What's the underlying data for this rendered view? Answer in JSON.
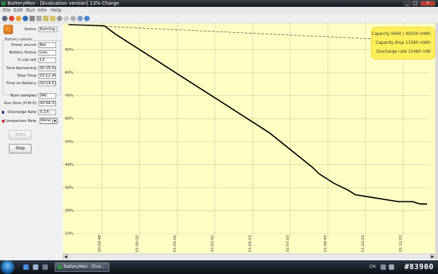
{
  "window": {
    "title": "BatteryMon - [Evaluation version] 13% Charge",
    "min": "_",
    "max": "□",
    "close": "×"
  },
  "menu": [
    "File",
    "Edit",
    "Run",
    "Info",
    "Help"
  ],
  "panel": {
    "status_label": "Status",
    "status_value": "Running",
    "group_title": "Battery details",
    "rows": [
      {
        "label": "Power source",
        "value": "Bat"
      },
      {
        "label": "Battery Status",
        "value": "Low"
      },
      {
        "label": "% Life left",
        "value": "13"
      },
      {
        "label": "Time Remaining",
        "value": "00:25:04"
      },
      {
        "label": "Total Time",
        "value": "03:12:49"
      },
      {
        "label": "Time on Battery",
        "value": "00:14:51"
      }
    ],
    "num_samples_label": "Num samples",
    "num_samples_value": "340",
    "run_time_label": "Run time (H:M:S)",
    "run_time_value": "00:56:33",
    "discharge_label": "Discharge Rate",
    "discharge_value": "3.2/h",
    "comparison_label": "Comparison Rate",
    "comparison_value": "None",
    "start_button": "Start",
    "stop_button": "Stop",
    "colors": {
      "discharge": "#1a1a80",
      "comparison": "#d42020"
    }
  },
  "info": {
    "capacity": "Capacity 6460 / 49330 mWh",
    "capacity_drop": "Capacity drop 11560 mWh",
    "discharge_rate": "Discharge rate 15480 mW"
  },
  "chart_data": {
    "type": "line",
    "y_ticks": [
      "10%",
      "20%",
      "30%",
      "40%",
      "50%",
      "60%",
      "70%",
      "80%",
      "90%"
    ],
    "x_ticks": [
      "00:59:48",
      "01:00:22",
      "01:02:02",
      "01:03:42",
      "01:05:23",
      "01:07:03",
      "01:08:43",
      "01:10:23",
      "01:12:03"
    ],
    "ylim": [
      10,
      100
    ],
    "grid": true,
    "background": "#ffffc4",
    "series": [
      {
        "style": "solid",
        "color": "#000000",
        "x": [
          0,
          0.1,
          0.13,
          0.16,
          0.2,
          0.24,
          0.28,
          0.32,
          0.36,
          0.4,
          0.44,
          0.48,
          0.52,
          0.56,
          0.6,
          0.64,
          0.68,
          0.7,
          0.74,
          0.78,
          0.8,
          0.84,
          0.88,
          0.92,
          0.96,
          0.98,
          1.0
        ],
        "values": [
          100,
          99.5,
          96,
          93,
          89,
          85,
          81,
          77,
          73,
          69,
          65,
          61,
          57,
          53,
          48,
          43,
          38,
          35,
          31,
          28,
          26,
          25,
          24,
          23,
          23,
          22,
          22
        ]
      },
      {
        "style": "dashed",
        "color": "#555555",
        "x": [
          0,
          1
        ],
        "values": [
          100,
          92.7
        ]
      }
    ]
  },
  "taskbar": {
    "task_label": "BatteryMon - [Eva...",
    "tray_lang": "CH",
    "watermark": "#83900"
  },
  "icons": [
    "app-icon",
    "toolbar-icons",
    "battery-logo-icon",
    "windows-orb-icon"
  ]
}
